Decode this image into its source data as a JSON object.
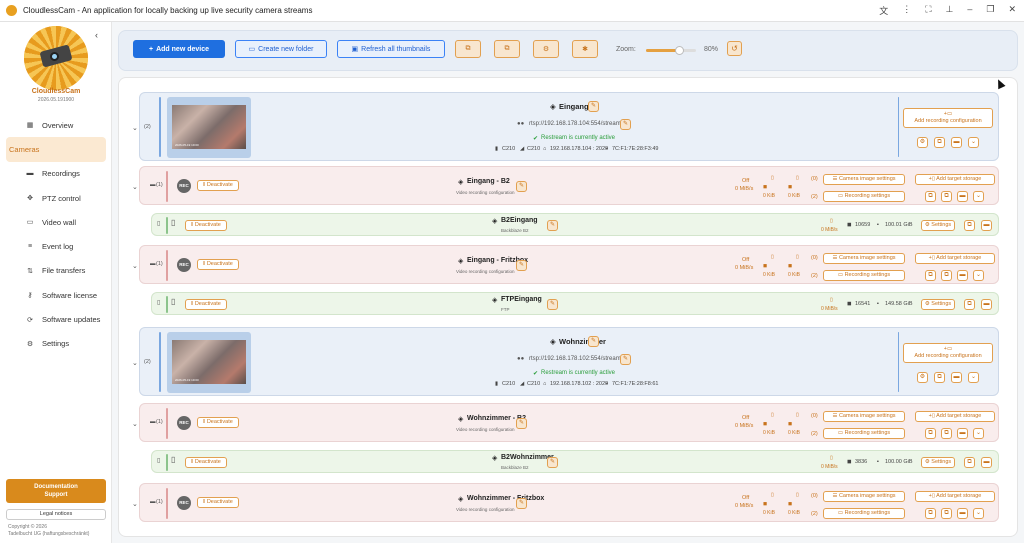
{
  "window": {
    "title": "CloudlessCam - An application for locally backing up live security camera streams"
  },
  "sidebar": {
    "brand": "CloudlessCam",
    "version": "2026.05.191900",
    "items": [
      {
        "label": "Overview",
        "icon": "grid-icon"
      },
      {
        "label": "Cameras",
        "icon": "camera-icon",
        "active": true
      },
      {
        "label": "Recordings",
        "icon": "video-icon"
      },
      {
        "label": "PTZ control",
        "icon": "move-icon"
      },
      {
        "label": "Video wall",
        "icon": "video-wall-icon"
      },
      {
        "label": "Event log",
        "icon": "list-icon"
      },
      {
        "label": "File transfers",
        "icon": "transfer-icon"
      },
      {
        "label": "Software license",
        "icon": "key-icon"
      },
      {
        "label": "Software updates",
        "icon": "refresh-icon"
      },
      {
        "label": "Settings",
        "icon": "gear-icon"
      }
    ],
    "doc_label": "Documentation",
    "support_label": "Support",
    "legal_label": "Legal notices",
    "copyright_1": "Copyright © 2026",
    "copyright_2": "Tadelbucht UG (haftungsbeschränkt)"
  },
  "toolbar": {
    "add_device": "Add new device",
    "create_folder": "Create new folder",
    "refresh_thumbs": "Refresh all thumbnails",
    "zoom_label": "Zoom:",
    "zoom_value": "80%",
    "zoom_fraction": 0.65
  },
  "cameras": [
    {
      "count": "(2)",
      "name": "Eingang",
      "url": "rtsp://192.168.178.104:554/stream1",
      "restream": "Restream is currently active",
      "model1": "C210",
      "model2": "C210",
      "ip": "192.168.178.104 : 2020",
      "mac": "7C:F1:7E:28:F3:49",
      "thumb_ts": "2026-05-19 19:00",
      "add_rec": "Add recording configuration",
      "recordings": [
        {
          "count": "(1)",
          "name": "Eingang - B2",
          "sub": "Video recording configuration",
          "rate": "0 MiB/s",
          "s1": "0 KiB",
          "s2": "0 KiB",
          "p1": "(0)",
          "p2": "(2)",
          "target": {
            "name": "B2Eingang",
            "sub": "Backblaze B2",
            "rate": "0 MiB/s",
            "files": "10659",
            "size": "100.01 GiB"
          }
        },
        {
          "count": "(1)",
          "name": "Eingang - Fritzbox",
          "sub": "Video recording configuration",
          "rate": "0 MiB/s",
          "s1": "0 KiB",
          "s2": "0 KiB",
          "p1": "(0)",
          "p2": "(2)",
          "target": {
            "name": "FTPEingang",
            "sub": "FTP",
            "rate": "0 MiB/s",
            "files": "16541",
            "size": "149.58 GiB"
          }
        }
      ]
    },
    {
      "count": "(2)",
      "name": "Wohnzimmer",
      "url": "rtsp://192.168.178.102:554/stream1",
      "restream": "Restream is currently active",
      "model1": "C210",
      "model2": "C210",
      "ip": "192.168.178.102 : 2020",
      "mac": "7C:F1:7E:28:F8:61",
      "thumb_ts": "2026-05-19 19:00",
      "add_rec": "Add recording configuration",
      "recordings": [
        {
          "count": "(1)",
          "name": "Wohnzimmer - B2",
          "sub": "Video recording configuration",
          "rate": "0 MiB/s",
          "s1": "0 KiB",
          "s2": "0 KiB",
          "p1": "(0)",
          "p2": "(2)",
          "target": {
            "name": "B2Wohnzimmer",
            "sub": "Backblaze B2",
            "rate": "0 MiB/s",
            "files": "3836",
            "size": "100.00 GiB"
          }
        },
        {
          "count": "(1)",
          "name": "Wohnzimmer - Fritzbox",
          "sub": "Video recording configuration",
          "rate": "0 MiB/s",
          "s1": "0 KiB",
          "s2": "0 KiB",
          "p1": "(0)",
          "p2": "(2)"
        }
      ]
    }
  ],
  "labels": {
    "deactivate": "Deactivate",
    "rec": "REC",
    "camera_image_settings": "Camera image settings",
    "recording_settings": "Recording settings",
    "add_target_storage": "Add target storage",
    "settings": "Settings",
    "off": "Off"
  },
  "colors": {
    "accent": "#c8731c",
    "primary": "#1f6fe0",
    "camera_row": "#eaf0f8",
    "recording_row": "#f9eded",
    "target_row": "#edf6e9"
  }
}
